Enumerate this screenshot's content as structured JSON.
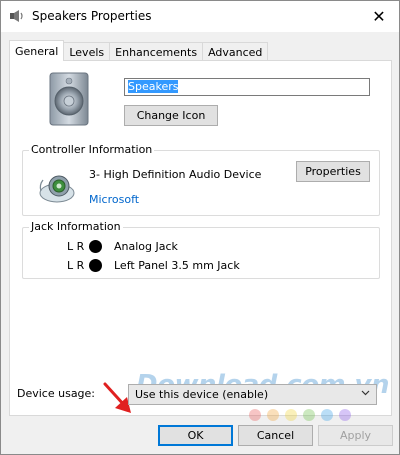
{
  "window": {
    "title": "Speakers Properties",
    "close_glyph": "✕"
  },
  "tabs": [
    {
      "label": "General",
      "active": true
    },
    {
      "label": "Levels",
      "active": false
    },
    {
      "label": "Enhancements",
      "active": false
    },
    {
      "label": "Advanced",
      "active": false
    }
  ],
  "general": {
    "device_name_value": "Speakers",
    "change_icon_label": "Change Icon"
  },
  "controller": {
    "group_label": "Controller Information",
    "device_name": "3- High Definition Audio Device",
    "vendor": "Microsoft",
    "properties_label": "Properties"
  },
  "jack": {
    "group_label": "Jack Information",
    "rows": [
      {
        "lr": "L R",
        "name": "Analog Jack"
      },
      {
        "lr": "L R",
        "name": "Left Panel 3.5 mm Jack"
      }
    ]
  },
  "usage": {
    "label": "Device usage:",
    "selected": "Use this device (enable)"
  },
  "footer": {
    "ok_label": "OK",
    "cancel_label": "Cancel",
    "apply_label": "Apply"
  },
  "watermark": {
    "text": "Download.com.vn",
    "dot_colors": [
      "#e85a5a",
      "#f2a33a",
      "#f2d43a",
      "#6cc04a",
      "#3aa0e8",
      "#8a5ae8"
    ]
  },
  "colors": {
    "accent": "#0078d7",
    "link": "#0066cc",
    "arrow": "#e02020"
  }
}
